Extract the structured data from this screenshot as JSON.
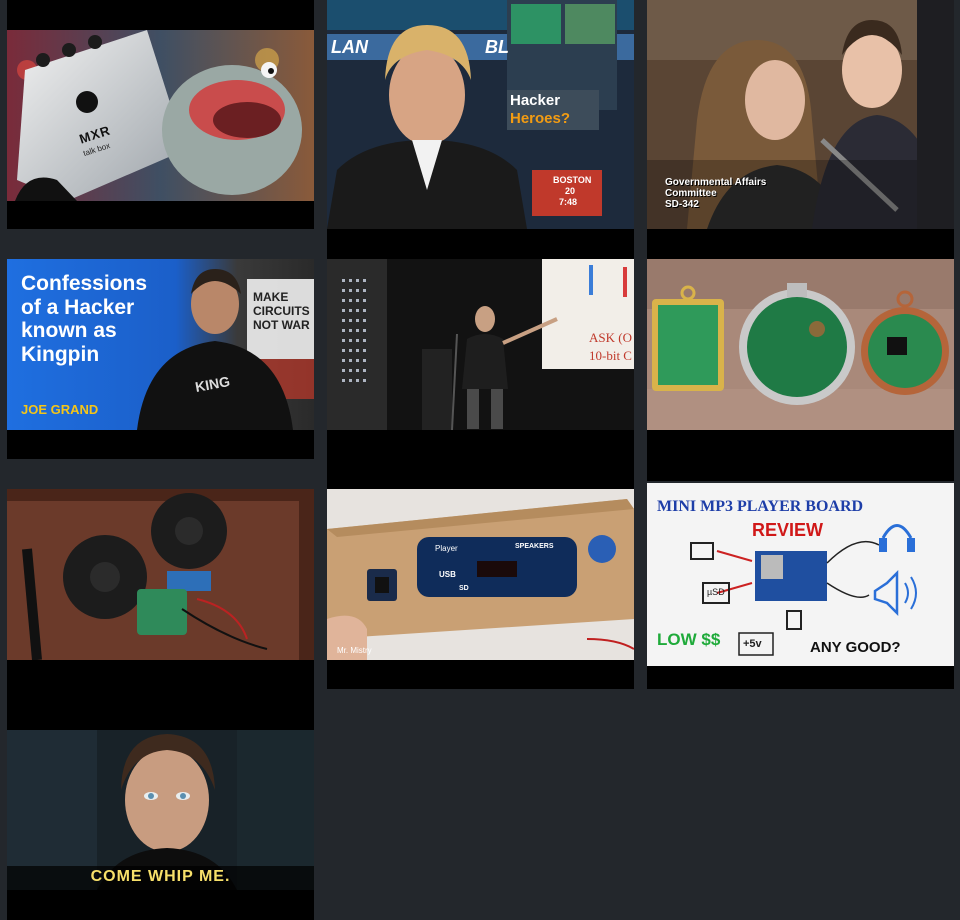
{
  "videos": [
    {
      "id": "v1",
      "scene": "talkbox-pedal-puppet",
      "overlay": {
        "brand": "MXR",
        "product": "talk box"
      }
    },
    {
      "id": "v2",
      "scene": "news-anchor",
      "overlay": {
        "banner_left": "LAN",
        "banner_right": "BL",
        "headline_1": "Hacker",
        "headline_2": "Heroes?",
        "city": "BOSTON",
        "temperature": "20",
        "time": "7:48"
      }
    },
    {
      "id": "v3",
      "scene": "senate-hearing",
      "overlay": {
        "line_1": "Governmental Affairs",
        "line_2": "Committee",
        "line_3": "SD-342"
      }
    },
    {
      "id": "v4",
      "scene": "confessions-kingpin",
      "overlay": {
        "title_1": "Confessions",
        "title_2": "of a Hacker",
        "title_3": "known as",
        "title_4": "Kingpin",
        "author": "JOE GRAND",
        "sign_1": "MAKE",
        "sign_2": "CIRCUITS",
        "sign_3": "NOT WAR",
        "shirt": "KING"
      }
    },
    {
      "id": "v5",
      "scene": "conference-talk",
      "overlay": {
        "slide_1": "ASK (O",
        "slide_2": "10-bit C"
      }
    },
    {
      "id": "v6",
      "scene": "circuit-board-pendants",
      "overlay": {}
    },
    {
      "id": "v7",
      "scene": "speaker-box-diy",
      "overlay": {}
    },
    {
      "id": "v8",
      "scene": "cardboard-mp3-player",
      "overlay": {
        "module_brand": "Player",
        "module_label": "SPEAKERS",
        "usb": "USB",
        "sd": "SD",
        "watermark": "Mr. Mistry"
      }
    },
    {
      "id": "v9",
      "scene": "mini-mp3-review",
      "overlay": {
        "title": "MINI MP3 PLAYER BOARD",
        "subtitle": "REVIEW",
        "price": "LOW $$",
        "question": "ANY GOOD?",
        "voltage": "+5v",
        "card": "µSD"
      }
    },
    {
      "id": "v10",
      "scene": "movie-still-caption",
      "overlay": {
        "caption": "COME WHIP ME."
      }
    }
  ]
}
